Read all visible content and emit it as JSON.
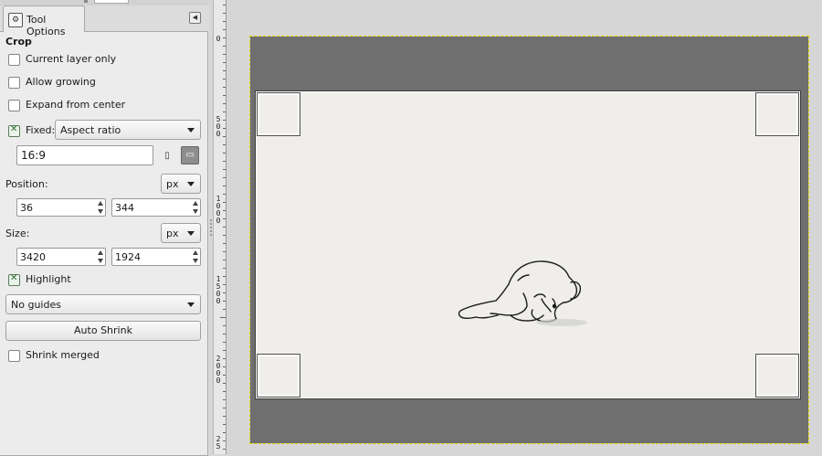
{
  "panel": {
    "tab_label": "Tool Options",
    "title": "Crop",
    "current_layer_only": {
      "label": "Current layer only",
      "checked": false
    },
    "allow_growing": {
      "label": "Allow growing",
      "checked": false
    },
    "expand_from_center": {
      "label": "Expand from center",
      "checked": false
    },
    "fixed": {
      "label": "Fixed:",
      "checked": true,
      "mode": "Aspect ratio",
      "value": "16:9"
    },
    "position": {
      "label": "Position:",
      "unit": "px",
      "x": "36",
      "y": "344"
    },
    "size": {
      "label": "Size:",
      "unit": "px",
      "w": "3420",
      "h": "1924"
    },
    "highlight": {
      "label": "Highlight",
      "checked": true
    },
    "guides": "No guides",
    "auto_shrink_label": "Auto Shrink",
    "shrink_merged": {
      "label": "Shrink merged",
      "checked": false
    }
  },
  "ruler_labels": [
    {
      "digits": "0"
    },
    {
      "digits": "500"
    },
    {
      "digits": "1000"
    },
    {
      "digits": "1500"
    },
    {
      "digits": "2000"
    },
    {
      "digits": "25"
    }
  ]
}
